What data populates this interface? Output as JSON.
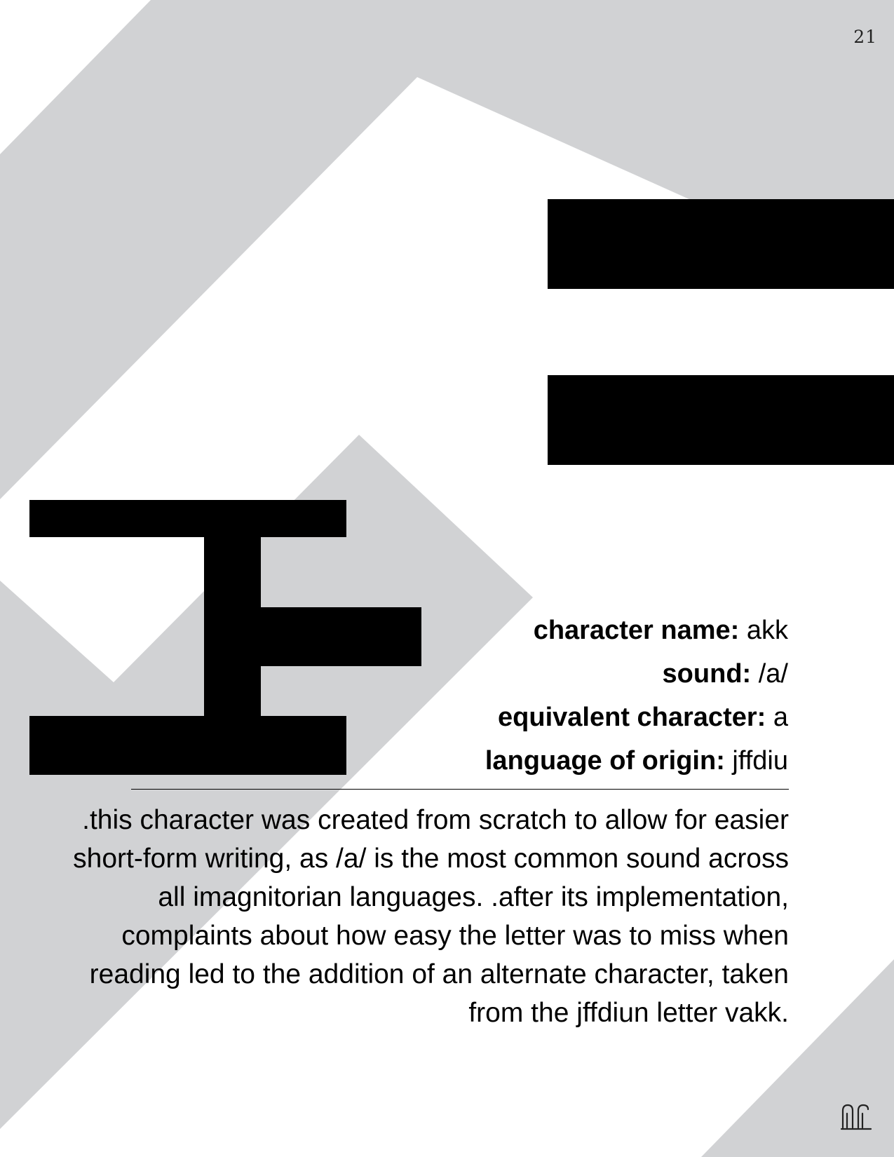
{
  "page_number": "21",
  "info": [
    {
      "label": "character name:",
      "value": " akk"
    },
    {
      "label": "sound:",
      "value": " /a/"
    },
    {
      "label": "equivalent character:",
      "value": " a"
    },
    {
      "label": "language of origin:",
      "value": " jffdiu"
    }
  ],
  "description": ".this character was created from scratch to allow for easier short-form writing, as /a/ is the most common sound across all imagnitorian languages. .after its implementation, complaints about how easy the letter was to miss when reading led to the addition of an alternate character, taken from the jffdiun letter vakk.",
  "colors": {
    "background": "#ffffff",
    "shape_gray": "#d1d2d4",
    "ink": "#000000"
  },
  "icons": {
    "footer": "script-glyph-logo-icon"
  }
}
